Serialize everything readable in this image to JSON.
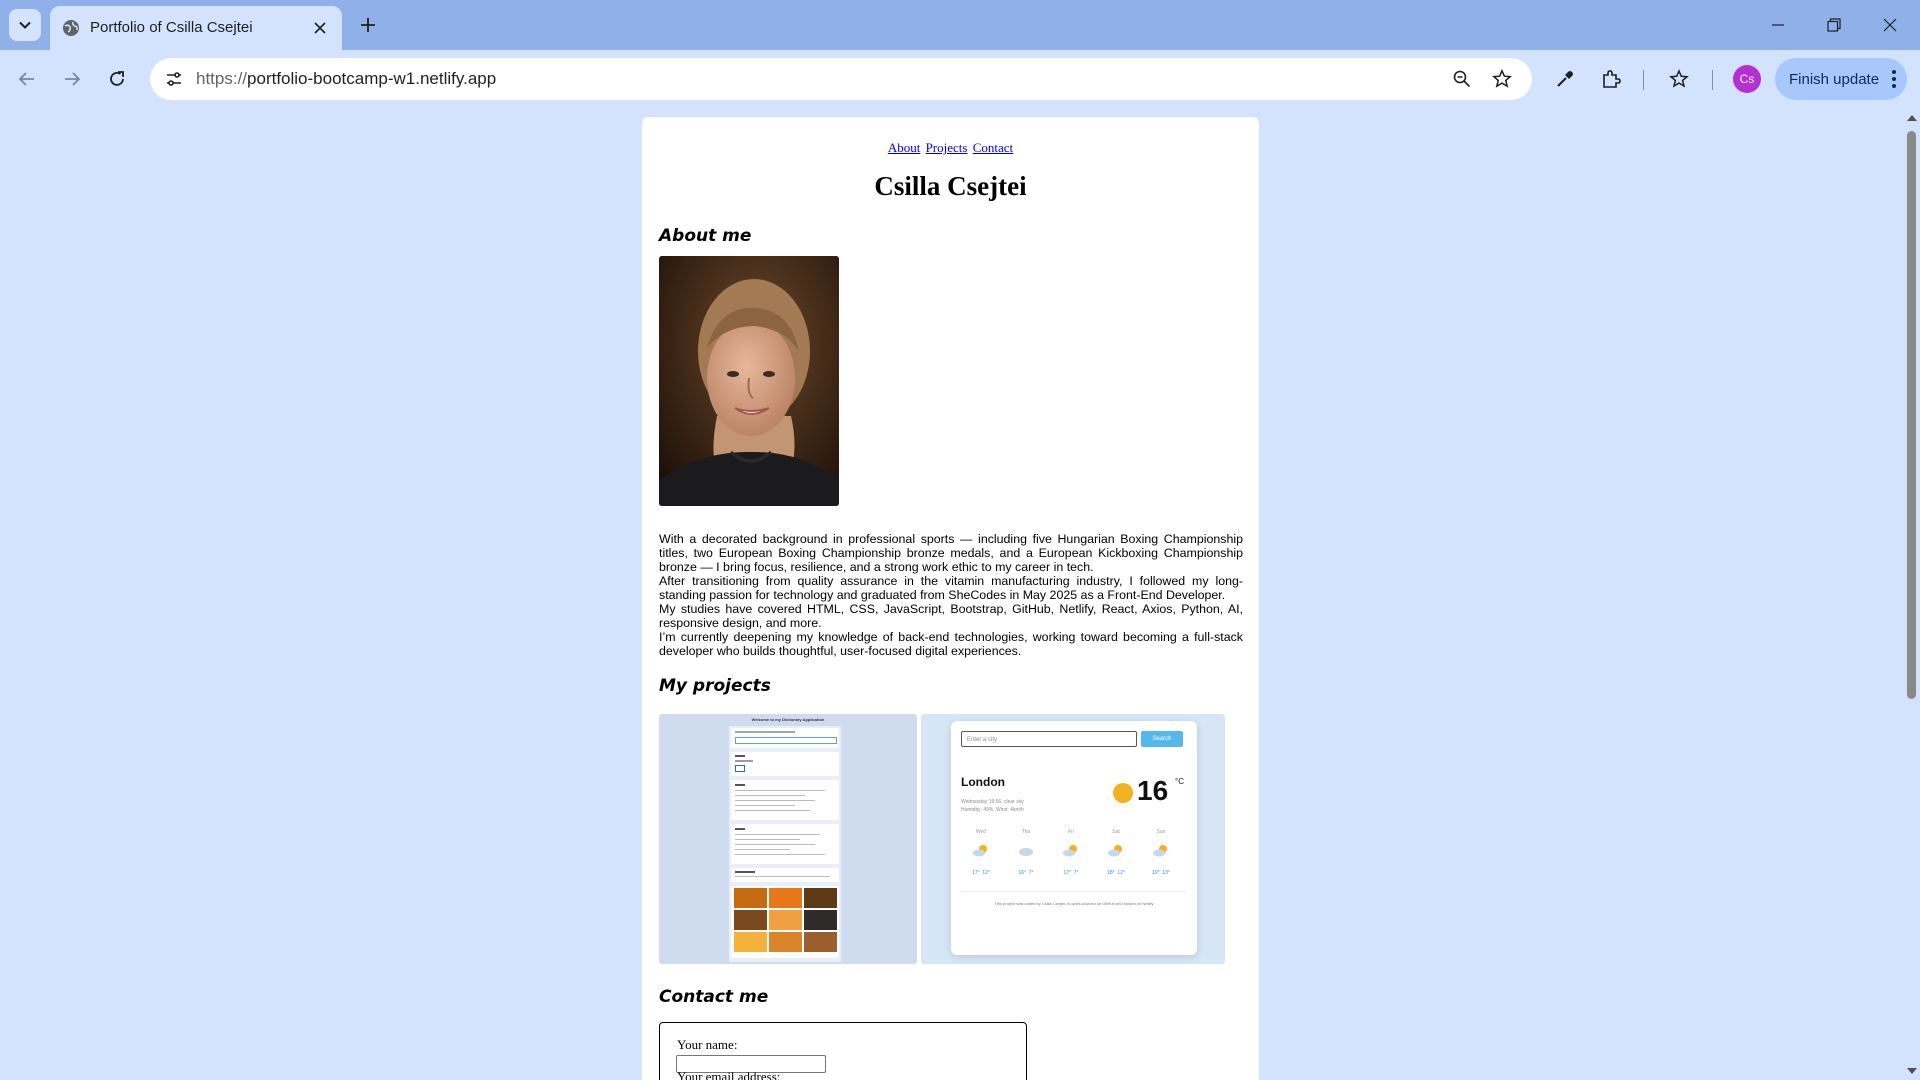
{
  "browser": {
    "tab_title": "Portfolio of Csilla Csejtei",
    "url_protocol": "https://",
    "url_host": "portfolio-bootcamp-w1.netlify.app",
    "profile_initials": "Cs",
    "update_button": "Finish update"
  },
  "nav": {
    "about": "About",
    "projects": "Projects",
    "contact": "Contact"
  },
  "header": {
    "name": "Csilla Csejtei"
  },
  "about": {
    "heading": "About me",
    "paragraphs": [
      "With a decorated background in professional sports — including five Hungarian Boxing Championship titles, two European Boxing Championship bronze medals, and a European Kickboxing Championship bronze — I bring focus, resilience, and a strong work ethic to my career in tech.",
      "After transitioning from quality assurance in the vitamin manufacturing industry, I followed my long-standing passion for technology and graduated from SheCodes in May 2025 as a Front-End Developer.",
      "My studies have covered HTML, CSS, JavaScript, Bootstrap, GitHub, Netlify, React, Axios, Python, AI, responsive design, and more.",
      "I’m currently deepening my knowledge of back-end technologies, working toward becoming a full-stack developer who builds thoughtful, user-focused digital experiences."
    ]
  },
  "projects": {
    "heading": "My projects",
    "dictionary_preview": {
      "title": "Welcome to my Dictionary Application"
    },
    "weather_preview": {
      "search_placeholder": "Enter a city",
      "search_button": "Search",
      "city": "London",
      "details_line1": "Wednesday 19:56, clear sky",
      "details_line2": "Humidity: 49%, Wind: 4km/h",
      "temperature": "16",
      "unit": "°C",
      "forecast": [
        {
          "day": "Wed",
          "high": "17°",
          "low": "12°"
        },
        {
          "day": "Thu",
          "high": "16°",
          "low": "7°"
        },
        {
          "day": "Fri",
          "high": "17°",
          "low": "7°"
        },
        {
          "day": "Sat",
          "high": "18°",
          "low": "12°"
        },
        {
          "day": "Sun",
          "high": "19°",
          "low": "13°"
        }
      ],
      "footer": "This project was coded by Csilla Csejtei, is open-sourced on GitHub and hosted on Netlify"
    }
  },
  "contact": {
    "heading": "Contact me",
    "name_label": "Your name:",
    "email_label": "Your email address:"
  }
}
